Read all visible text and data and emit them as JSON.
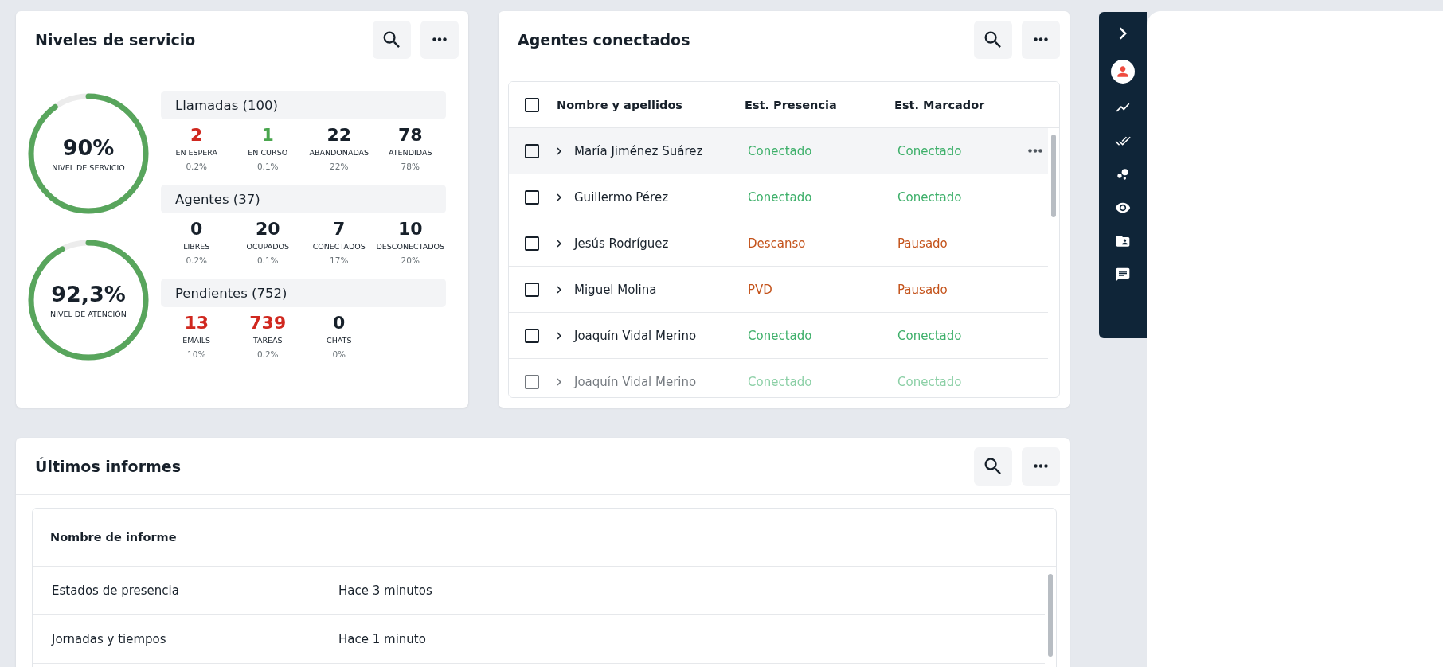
{
  "service_levels": {
    "title": "Niveles de servicio",
    "gauges": [
      {
        "value": "90%",
        "label": "NIVEL DE SERVICIO",
        "level": 0.9
      },
      {
        "value": "92,3%",
        "label": "NIVEL DE ATENCIÓN",
        "level": 0.923
      }
    ],
    "groups": [
      {
        "title": "Llamadas (100)",
        "stats": [
          {
            "value": "2",
            "label": "EN ESPERA",
            "share": "0.2%",
            "kind": "alert"
          },
          {
            "value": "1",
            "label": "EN CURSO",
            "share": "0.1%",
            "kind": "good"
          },
          {
            "value": "22",
            "label": "ABANDONADAS",
            "share": "22%",
            "kind": "plain"
          },
          {
            "value": "78",
            "label": "ATENDIDAS",
            "share": "78%",
            "kind": "plain"
          }
        ]
      },
      {
        "title": "Agentes (37)",
        "stats": [
          {
            "value": "0",
            "label": "LIBRES",
            "share": "0.2%",
            "kind": "plain"
          },
          {
            "value": "20",
            "label": "OCUPADOS",
            "share": "0.1%",
            "kind": "plain"
          },
          {
            "value": "7",
            "label": "CONECTADOS",
            "share": "17%",
            "kind": "plain"
          },
          {
            "value": "10",
            "label": "DESCONECTADOS",
            "share": "20%",
            "kind": "plain"
          }
        ]
      },
      {
        "title": "Pendientes (752)",
        "stats": [
          {
            "value": "13",
            "label": "EMAILS",
            "share": "10%",
            "kind": "alert"
          },
          {
            "value": "739",
            "label": "TAREAS",
            "share": "0.2%",
            "kind": "alert"
          },
          {
            "value": "0",
            "label": "CHATS",
            "share": "0%",
            "kind": "plain"
          }
        ]
      }
    ]
  },
  "agents": {
    "title": "Agentes conectados",
    "select_all": {
      "checked": false
    },
    "columns": [
      "Nombre y apellidos",
      "Est. Presencia",
      "Est. Marcador"
    ],
    "rows": [
      {
        "name": "María Jiménez Suárez",
        "presence": {
          "text": "Conectado",
          "kind": "ok"
        },
        "dialer": {
          "text": "Conectado",
          "kind": "ok"
        },
        "checked": false,
        "highlighted": true,
        "faded": false
      },
      {
        "name": "Guillermo Pérez",
        "presence": {
          "text": "Conectado",
          "kind": "ok"
        },
        "dialer": {
          "text": "Conectado",
          "kind": "ok"
        },
        "checked": false,
        "highlighted": false,
        "faded": false
      },
      {
        "name": "Jesús Rodríguez",
        "presence": {
          "text": "Descanso",
          "kind": "away"
        },
        "dialer": {
          "text": "Pausado",
          "kind": "away"
        },
        "checked": false,
        "highlighted": false,
        "faded": false
      },
      {
        "name": "Miguel Molina",
        "presence": {
          "text": "PVD",
          "kind": "away"
        },
        "dialer": {
          "text": "Pausado",
          "kind": "away"
        },
        "checked": false,
        "highlighted": false,
        "faded": false
      },
      {
        "name": "Joaquín Vidal Merino",
        "presence": {
          "text": "Conectado",
          "kind": "ok"
        },
        "dialer": {
          "text": "Conectado",
          "kind": "ok"
        },
        "checked": false,
        "highlighted": false,
        "faded": false
      },
      {
        "name": "Joaquín Vidal Merino",
        "presence": {
          "text": "Conectado",
          "kind": "ok"
        },
        "dialer": {
          "text": "Conectado",
          "kind": "ok"
        },
        "checked": false,
        "highlighted": false,
        "faded": true
      }
    ]
  },
  "reports": {
    "title": "Últimos informes",
    "columns": [
      "Nombre de informe"
    ],
    "rows": [
      {
        "name": "Estados de presencia",
        "time": "Hace 3 minutos"
      },
      {
        "name": "Jornadas y tiempos",
        "time": "Hace 1 minuto"
      }
    ]
  },
  "sidebar": {
    "items": [
      {
        "kind": "person",
        "selected": true
      },
      {
        "kind": "trend",
        "selected": false
      },
      {
        "kind": "checks",
        "selected": false
      },
      {
        "kind": "bubbles",
        "selected": false
      },
      {
        "kind": "eye",
        "selected": false
      },
      {
        "kind": "folder",
        "selected": false
      },
      {
        "kind": "chat",
        "selected": false
      }
    ]
  }
}
